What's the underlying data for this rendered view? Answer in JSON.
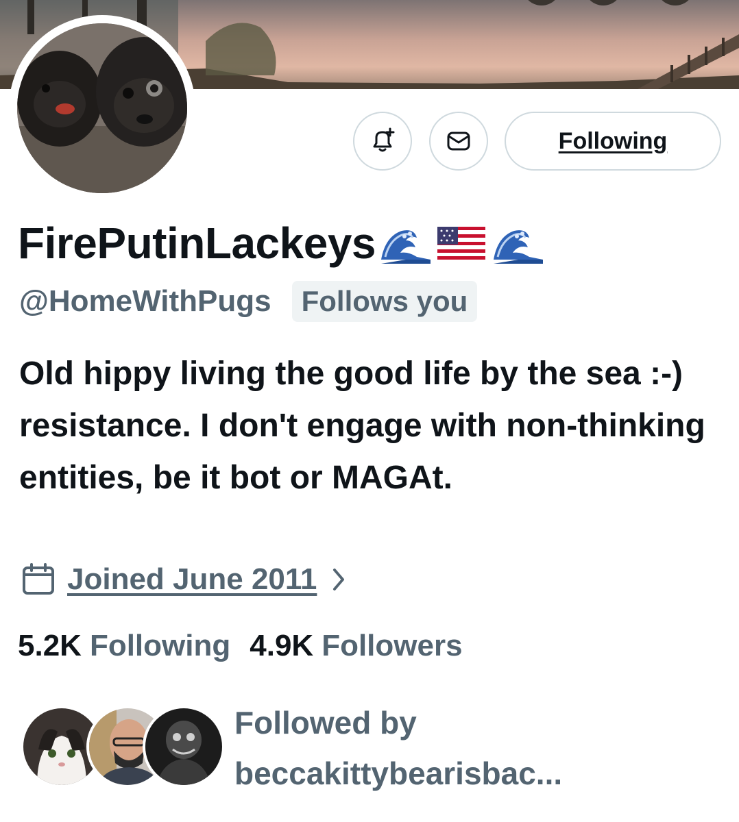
{
  "header": {
    "display_name": "FirePutinLackeys",
    "name_emojis": [
      "wave-emoji",
      "us-flag-emoji",
      "wave-emoji"
    ],
    "handle": "@HomeWithPugs",
    "follows_you_badge": "Follows you"
  },
  "actions": {
    "notify_icon": "bell-plus-icon",
    "message_icon": "envelope-icon",
    "follow_label": "Following"
  },
  "bio": "Old hippy living the good life by the sea :-) resistance. I don't engage with non-thinking entities, be it bot or MAGAt.",
  "joined": {
    "icon": "calendar-icon",
    "label": "Joined June 2011"
  },
  "stats": {
    "following_count": "5.2K",
    "following_label": "Following",
    "followers_count": "4.9K",
    "followers_label": "Followers"
  },
  "followed_by": {
    "line1": "Followed by",
    "line2": "beccakittybearisbac..."
  },
  "colors": {
    "text_primary": "#0f1419",
    "text_secondary": "#536471",
    "border": "#cfd9de",
    "badge_bg": "#eff3f4"
  }
}
